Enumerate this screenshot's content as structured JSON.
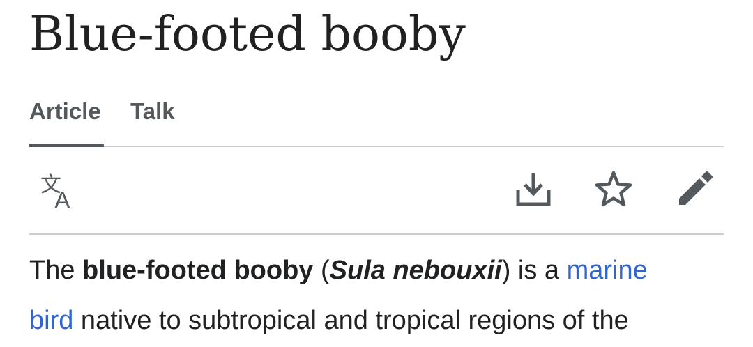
{
  "article": {
    "title": "Blue-footed booby"
  },
  "tabs": [
    {
      "label": "Article",
      "selected": true
    },
    {
      "label": "Talk",
      "selected": false
    }
  ],
  "toolbar": {
    "icons": [
      "language-icon",
      "download-icon",
      "star-icon",
      "pencil-icon"
    ]
  },
  "intro": {
    "t1": "The ",
    "bold_name": "blue-footed booby",
    "t2": " (",
    "scientific_name": "Sula nebouxii",
    "t3": ") is a ",
    "link1_line1": "marine",
    "link1_line2": "bird",
    "t4": " native to subtropical and tropical regions of the"
  },
  "colors": {
    "text": "#202122",
    "tab_text": "#54595d",
    "link": "#3366cc",
    "divider": "#c8ccd1"
  }
}
